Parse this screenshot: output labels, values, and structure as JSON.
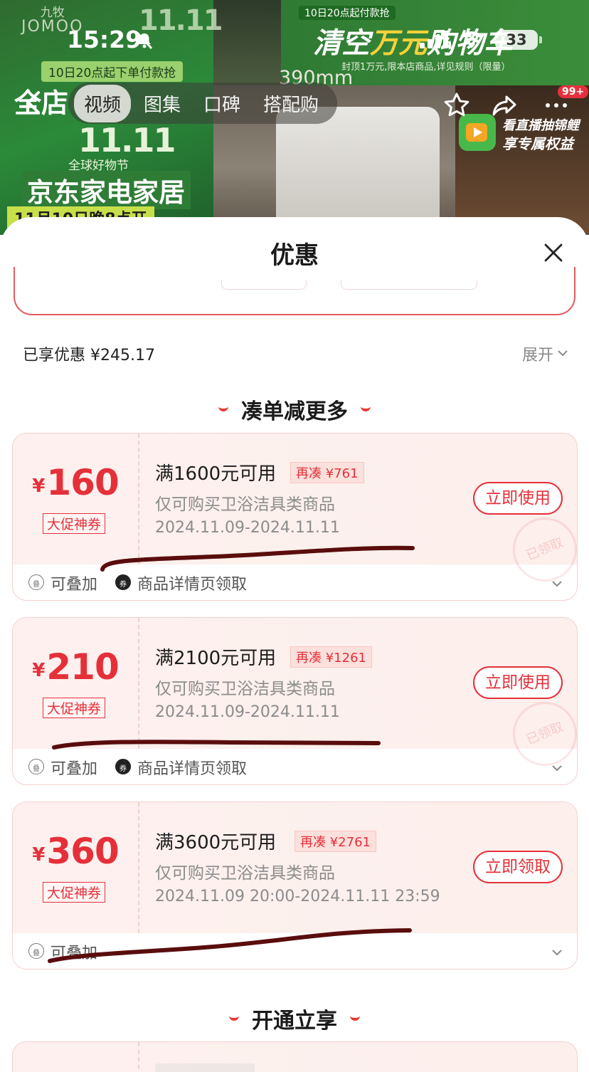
{
  "status_bar": {
    "time": "15:29",
    "battery": "33"
  },
  "banner": {
    "brand_cn": "九牧",
    "brand_en": "JOMOO",
    "eleven": "11.11",
    "promo_start": "10日20点起下单付款抢",
    "all_store": "全店",
    "festival": "全球好物节",
    "jd_home": "京东家电家居",
    "nov_date": "11月10日晚8点开",
    "dimension": "390mm",
    "tag_10": "10日20点起付款抢",
    "clear_prefix": "清空",
    "clear_highlight": "万元",
    "clear_suffix": "购物车",
    "cap_note": "封顶1万元,限本店商品,详见规则（限量）",
    "live_line1": "看直播抽锦鲤",
    "live_line2": "享专属权益"
  },
  "nav": {
    "tabs": [
      {
        "label": "视频",
        "active": true
      },
      {
        "label": "图集",
        "active": false
      },
      {
        "label": "口碑",
        "active": false
      },
      {
        "label": "搭配购",
        "active": false
      }
    ],
    "badge": "99+"
  },
  "sheet": {
    "title": "优惠",
    "enjoyed": "已享优惠 ¥245.17",
    "expand": "展开",
    "section1": "凑单减更多",
    "section2": "开通立享"
  },
  "coupons": [
    {
      "yen": "¥",
      "amount": "160",
      "type": "大促神券",
      "condition": "满1600元可用",
      "more": "再凑 ¥761",
      "scope": "仅可购买卫浴洁具类商品",
      "date": "2024.11.09-2024.11.11",
      "action": "立即使用",
      "stamp": "已领取",
      "stackable": "可叠加",
      "source": "商品详情页领取"
    },
    {
      "yen": "¥",
      "amount": "210",
      "type": "大促神券",
      "condition": "满2100元可用",
      "more": "再凑 ¥1261",
      "scope": "仅可购买卫浴洁具类商品",
      "date": "2024.11.09-2024.11.11",
      "action": "立即使用",
      "stamp": "已领取",
      "stackable": "可叠加",
      "source": "商品详情页领取"
    },
    {
      "yen": "¥",
      "amount": "360",
      "type": "大促神券",
      "condition": "满3600元可用",
      "more": "再凑 ¥2761",
      "scope": "仅可购买卫浴洁具类商品",
      "date": "2024.11.09 20:00-2024.11.11 23:59",
      "action": "立即领取",
      "stackable": "可叠加"
    }
  ],
  "colors": {
    "accent": "#e5303a",
    "scribble": "#5a0d0d"
  }
}
